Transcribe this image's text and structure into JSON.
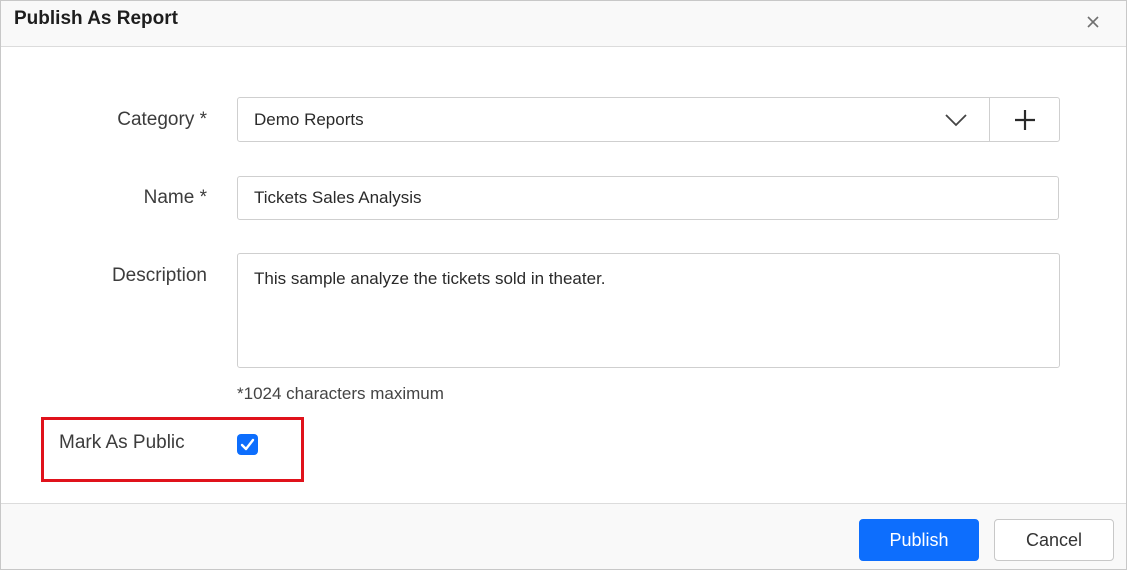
{
  "dialog": {
    "title": "Publish As Report",
    "close_icon": "close-icon"
  },
  "form": {
    "category": {
      "label": "Category *",
      "selected": "Demo Reports",
      "dropdown_icon": "chevron-down-icon",
      "add_icon": "plus-icon"
    },
    "name": {
      "label": "Name *",
      "value": "Tickets Sales Analysis"
    },
    "description": {
      "label": "Description",
      "value": "This sample analyze the tickets sold in theater.",
      "hint": "*1024 characters maximum"
    },
    "public": {
      "label": "Mark As Public",
      "checked": true,
      "highlight_color": "#e0121b"
    }
  },
  "footer": {
    "publish_label": "Publish",
    "cancel_label": "Cancel"
  },
  "colors": {
    "accent": "#0d6efd",
    "highlight": "#e0121b"
  }
}
